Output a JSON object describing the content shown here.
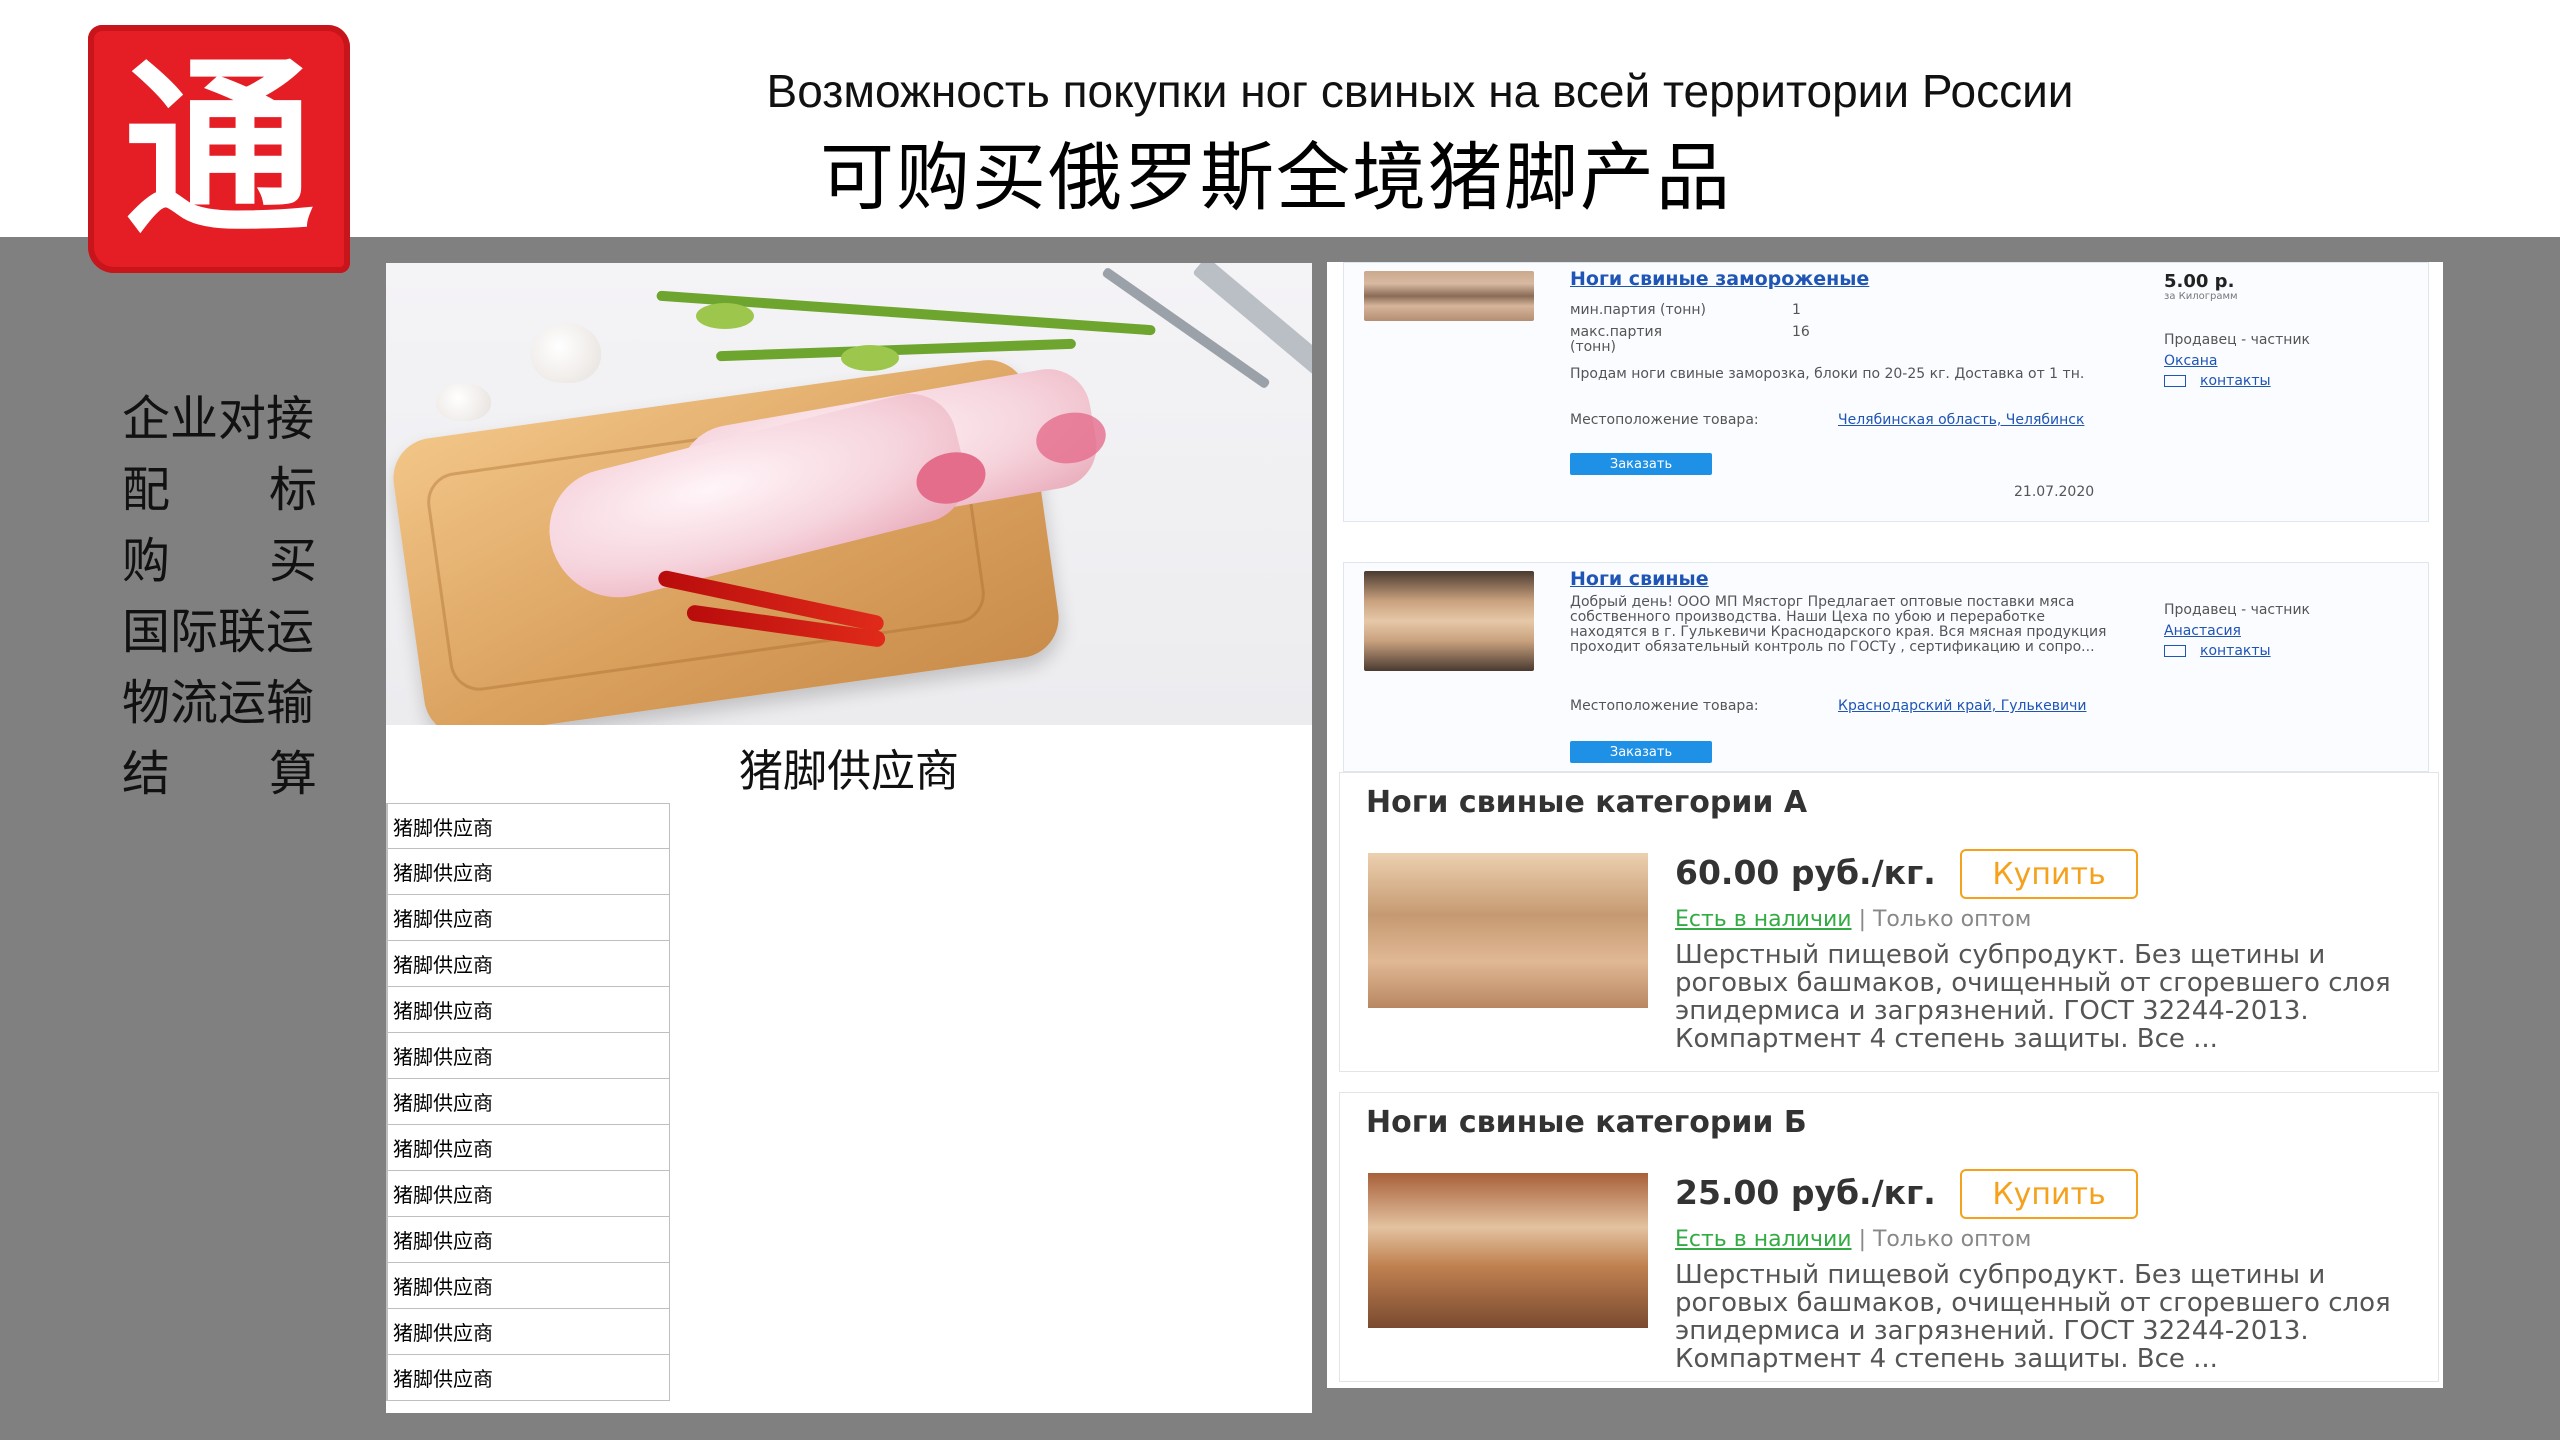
{
  "logo": {
    "glyph": "通"
  },
  "title": {
    "ru": "Возможность покупки ног свиных на всей территории России",
    "cn": "可购买俄罗斯全境猪脚产品"
  },
  "side_menu": [
    {
      "label": "企业对接",
      "parts": [
        "企业对接"
      ]
    },
    {
      "label": "配标",
      "parts": [
        "配",
        "标"
      ]
    },
    {
      "label": "购买",
      "parts": [
        "购",
        "买"
      ]
    },
    {
      "label": "国际联运",
      "parts": [
        "国际联运"
      ]
    },
    {
      "label": "物流运输",
      "parts": [
        "物流运输"
      ]
    },
    {
      "label": "结算",
      "parts": [
        "结",
        "算"
      ]
    }
  ],
  "left_panel": {
    "caption": "猪脚供应商",
    "suppliers": [
      "猪脚供应商",
      "猪脚供应商",
      "猪脚供应商",
      "猪脚供应商",
      "猪脚供应商",
      "猪脚供应商",
      "猪脚供应商",
      "猪脚供应商",
      "猪脚供应商",
      "猪脚供应商",
      "猪脚供应商",
      "猪脚供应商",
      "猪脚供应商"
    ]
  },
  "listings": [
    {
      "title": "Ноги свиные замороженые",
      "price": "5.00 р.",
      "unit": "за Килограмм",
      "min_label": "мин.партия (тонн)",
      "min_value": "1",
      "max_label": "макс.партия (тонн)",
      "max_value": "16",
      "description": "Продам ноги свиные заморозка, блоки по 20-25 кг. Доставка от 1 тн.",
      "location_label": "Местоположение товара:",
      "location": "Челябинская область, Челябинск",
      "seller_label": "Продавец - частник",
      "seller": "Оксана",
      "contacts": "контакты",
      "order": "Заказать",
      "date": "21.07.2020"
    },
    {
      "title": "Ноги свиные",
      "description": "Добрый день! ООО МП Мясторг Предлагает оптовые поставки мяса собственного производства. Наши Цеха по убою и переработке находятся в г. Гулькевичи Краснодарского края. Вся мясная продукция проходит обязательный контроль по ГОСТу , сертификацию и сопро...",
      "location_label": "Местоположение товара:",
      "location": "Краснодарский край, Гулькевичи",
      "seller_label": "Продавец - частник",
      "seller": "Анастасия",
      "contacts": "контакты",
      "order": "Заказать"
    }
  ],
  "cards": [
    {
      "title": "Ноги свиные категории А",
      "price": "60.00 руб./кг.",
      "buy": "Купить",
      "in_stock": "Есть в наличии",
      "wholesale": "| Только оптом",
      "description": "Шерстный пищевой субпродукт. Без щетины и роговых башмаков, очищенный от сгоревшего слоя эпидермиса и загрязнений. ГОСТ 32244-2013. Компартмент 4 степень защиты. Все ..."
    },
    {
      "title": "Ноги свиные категории Б",
      "price": "25.00 руб./кг.",
      "buy": "Купить",
      "in_stock": "Есть в наличии",
      "wholesale": "| Только оптом",
      "description": "Шерстный пищевой субпродукт. Без щетины и роговых башмаков, очищенный от сгоревшего слоя эпидермиса и загрязнений. ГОСТ 32244-2013. Компартмент 4 степень защиты. Все ..."
    }
  ]
}
